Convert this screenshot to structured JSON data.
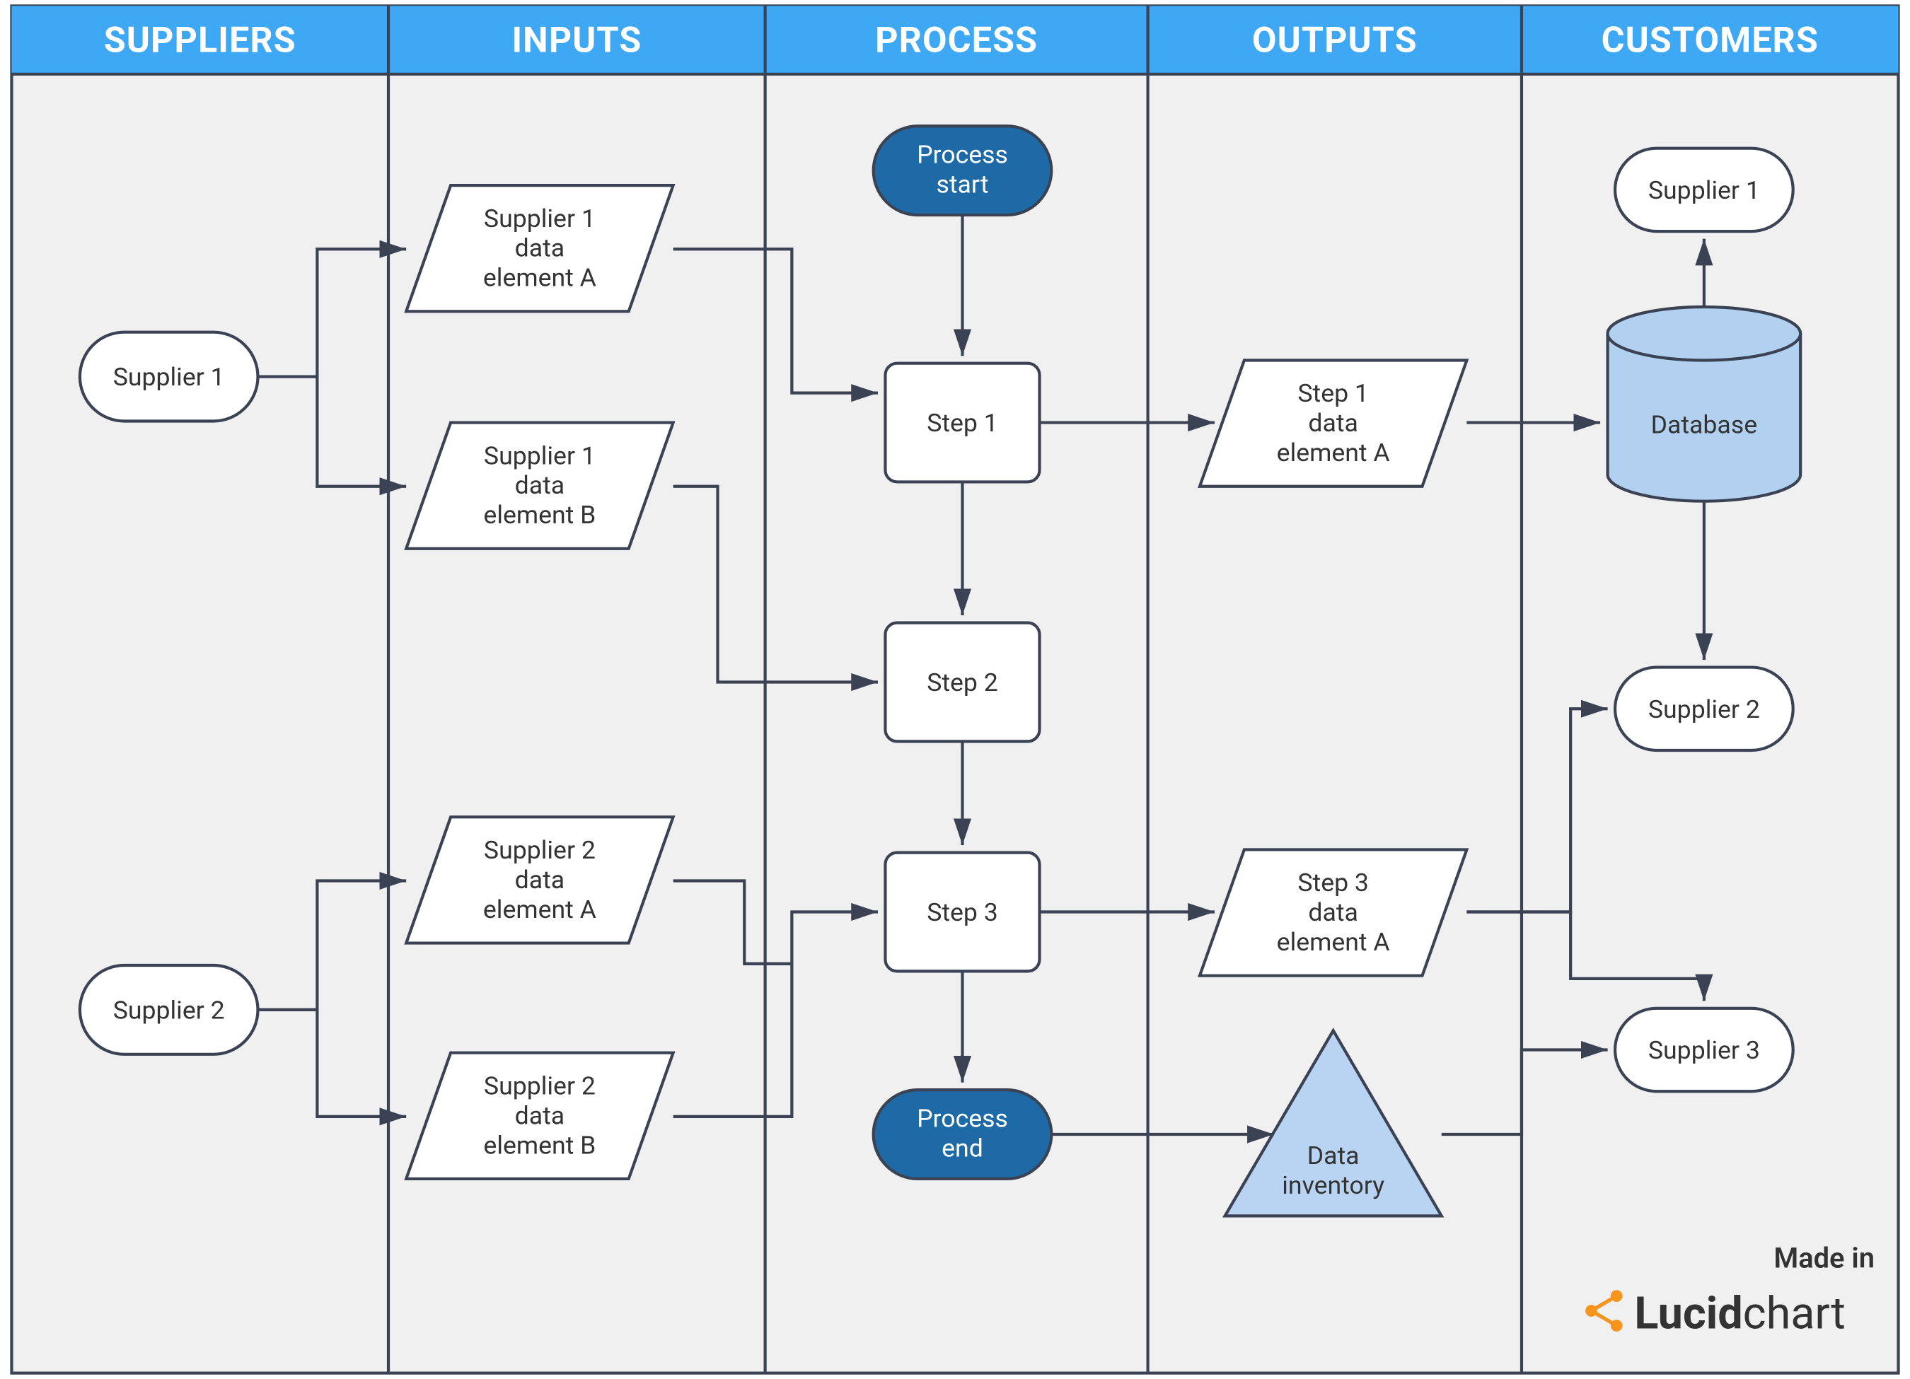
{
  "columns": [
    "SUPPLIERS",
    "INPUTS",
    "PROCESS",
    "OUTPUTS",
    "CUSTOMERS"
  ],
  "nodes": {
    "supplier1": "Supplier 1",
    "supplier2": "Supplier 2",
    "s1a1": "Supplier 1",
    "s1a2": "data",
    "s1a3": "element A",
    "s1b1": "Supplier 1",
    "s1b2": "data",
    "s1b3": "element B",
    "s2a1": "Supplier 2",
    "s2a2": "data",
    "s2a3": "element A",
    "s2b1": "Supplier 2",
    "s2b2": "data",
    "s2b3": "element B",
    "pstart1": "Process",
    "pstart2": "start",
    "step1": "Step 1",
    "step2": "Step 2",
    "step3": "Step 3",
    "pend1": "Process",
    "pend2": "end",
    "out1a": "Step 1",
    "out1b": "data",
    "out1c": "element A",
    "out3a": "Step 3",
    "out3b": "data",
    "out3c": "element A",
    "datainv1": "Data",
    "datainv2": "inventory",
    "cust1": "Supplier 1",
    "db": "Database",
    "cust2": "Supplier 2",
    "cust3": "Supplier 3"
  },
  "brand": {
    "made": "Made in",
    "name1": "Lucid",
    "name2": "chart"
  },
  "colors": {
    "header": "#3fa8f4",
    "stroke": "#3a4254",
    "accent": "#1e6aa6",
    "cyl": "#b2d1f0",
    "tri": "#b9d4f2"
  }
}
